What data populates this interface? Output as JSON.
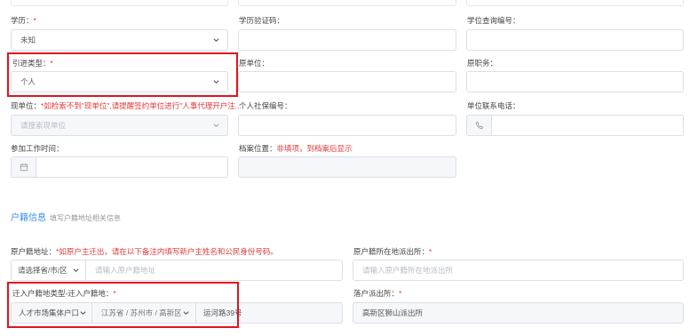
{
  "fields": {
    "education": {
      "label": "学历：",
      "req": "*",
      "value": "未知"
    },
    "edu_code": {
      "label": "学历验证码："
    },
    "degree_code": {
      "label": "学位查询编号："
    },
    "intro_type": {
      "label": "引进类型：",
      "req": "*",
      "value": "个人"
    },
    "orig_unit": {
      "label": "原单位："
    },
    "orig_post": {
      "label": "原职务："
    },
    "cur_unit": {
      "label": "现单位：",
      "hint": "*如检索不到\"现单位\",请提醒签约单位进行\"人事代理开户注...",
      "placeholder": "请搜索现单位"
    },
    "social_no": {
      "label": "个人社保编号："
    },
    "unit_phone": {
      "label": "单位联系电话："
    },
    "work_time": {
      "label": "参加工作时间："
    },
    "archive": {
      "label": "档案位置：",
      "hint": "非填项，到档案后显示"
    },
    "orig_hukou_addr": {
      "label": "原户籍地址：",
      "hint": "*如原户主迁出，请在以下备注内填写新户主姓名和公民身份号码。",
      "select_placeholder": "请选择省/市/区",
      "input_placeholder": "请输入原户籍地址"
    },
    "orig_police": {
      "label": "原户籍所在地派出所：",
      "req": "*",
      "placeholder": "请输入原户籍所在地派出所"
    },
    "move_in": {
      "label": "迁入户籍地类型-迁入户籍地：",
      "req": "*",
      "type_value": "人才市场集体户口",
      "region_value": "江苏省 / 苏州市 / 高新区",
      "addr_value": "运河路39号"
    },
    "settle_police": {
      "label": "落户派出所：",
      "req": "*",
      "value": "高新区狮山派出所"
    }
  },
  "section": {
    "title": "户籍信息",
    "subtitle": "填写户籍地址相关信息"
  },
  "colors": {
    "accent": "#3a8ee6",
    "required": "#e23a3a",
    "highlight": "#e0141e"
  },
  "icons": [
    "chevron-down-icon",
    "phone-icon",
    "calendar-icon"
  ]
}
